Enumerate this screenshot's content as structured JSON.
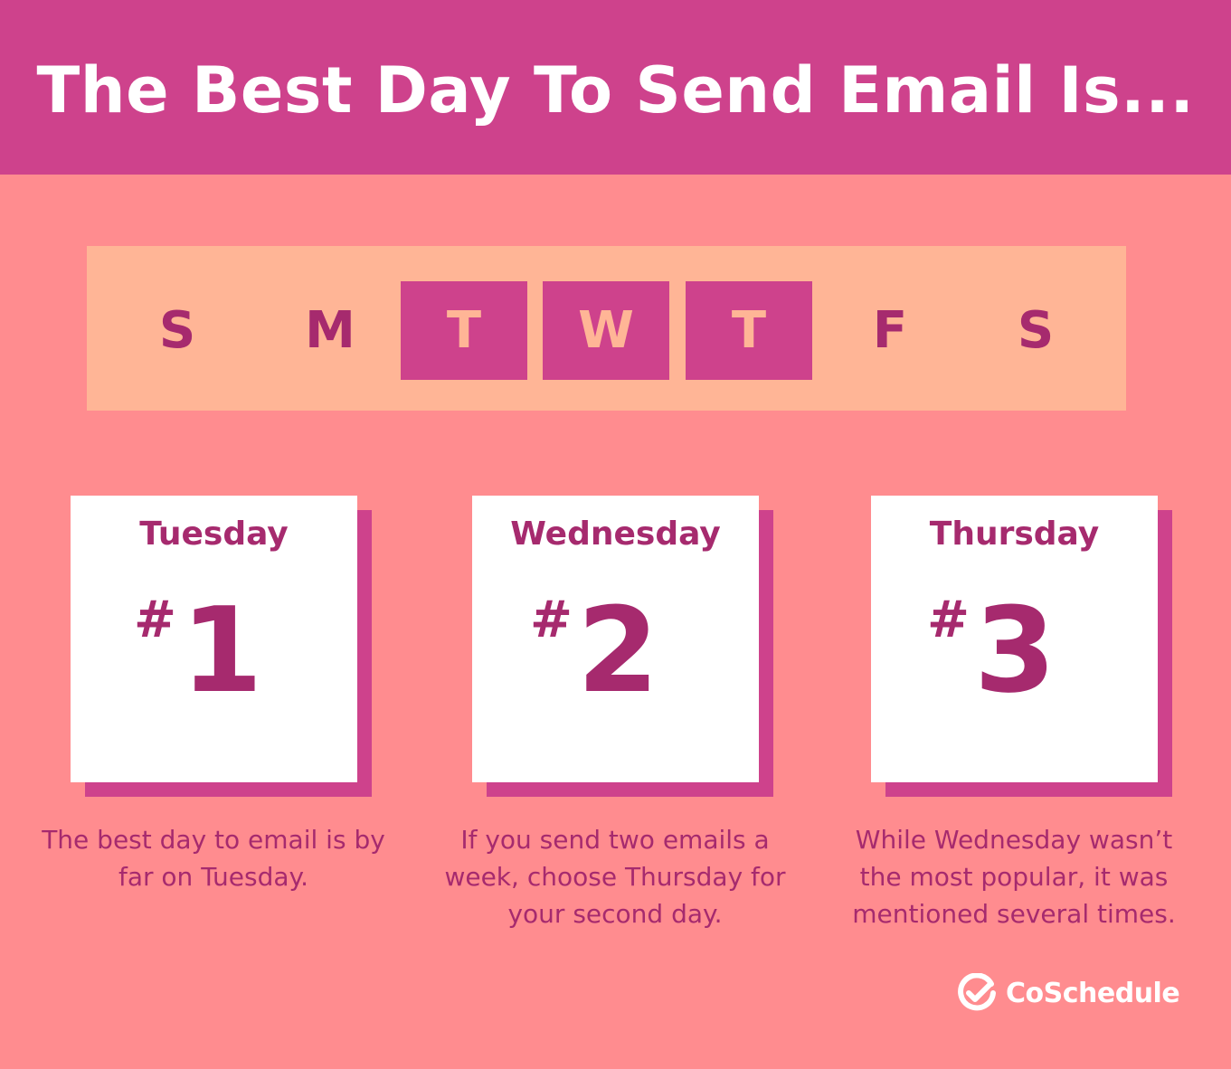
{
  "header": {
    "title": "The Best Day To Send Email Is..."
  },
  "week": {
    "days": [
      {
        "letter": "S",
        "highlighted": false
      },
      {
        "letter": "M",
        "highlighted": false
      },
      {
        "letter": "T",
        "highlighted": true
      },
      {
        "letter": "W",
        "highlighted": true
      },
      {
        "letter": "T",
        "highlighted": true
      },
      {
        "letter": "F",
        "highlighted": false
      },
      {
        "letter": "S",
        "highlighted": false
      }
    ]
  },
  "rankings": [
    {
      "day": "Tuesday",
      "hash": "#",
      "rank": "1",
      "description": "The best day to email is by far on Tuesday."
    },
    {
      "day": "Wednesday",
      "hash": "#",
      "rank": "2",
      "description": "If you send two emails a week, choose Thursday for your second day."
    },
    {
      "day": "Thursday",
      "hash": "#",
      "rank": "3",
      "description": "While Wednesday wasn’t the most popular, it was mentioned several times."
    }
  ],
  "brand": {
    "name": "CoSchedule",
    "icon": "coschedule-check-icon"
  },
  "colors": {
    "background": "#FF8C8F",
    "header": "#CE428C",
    "week_bar": "#FFB596",
    "text_dark": "#A62A6E",
    "card": "#FFFFFF"
  }
}
